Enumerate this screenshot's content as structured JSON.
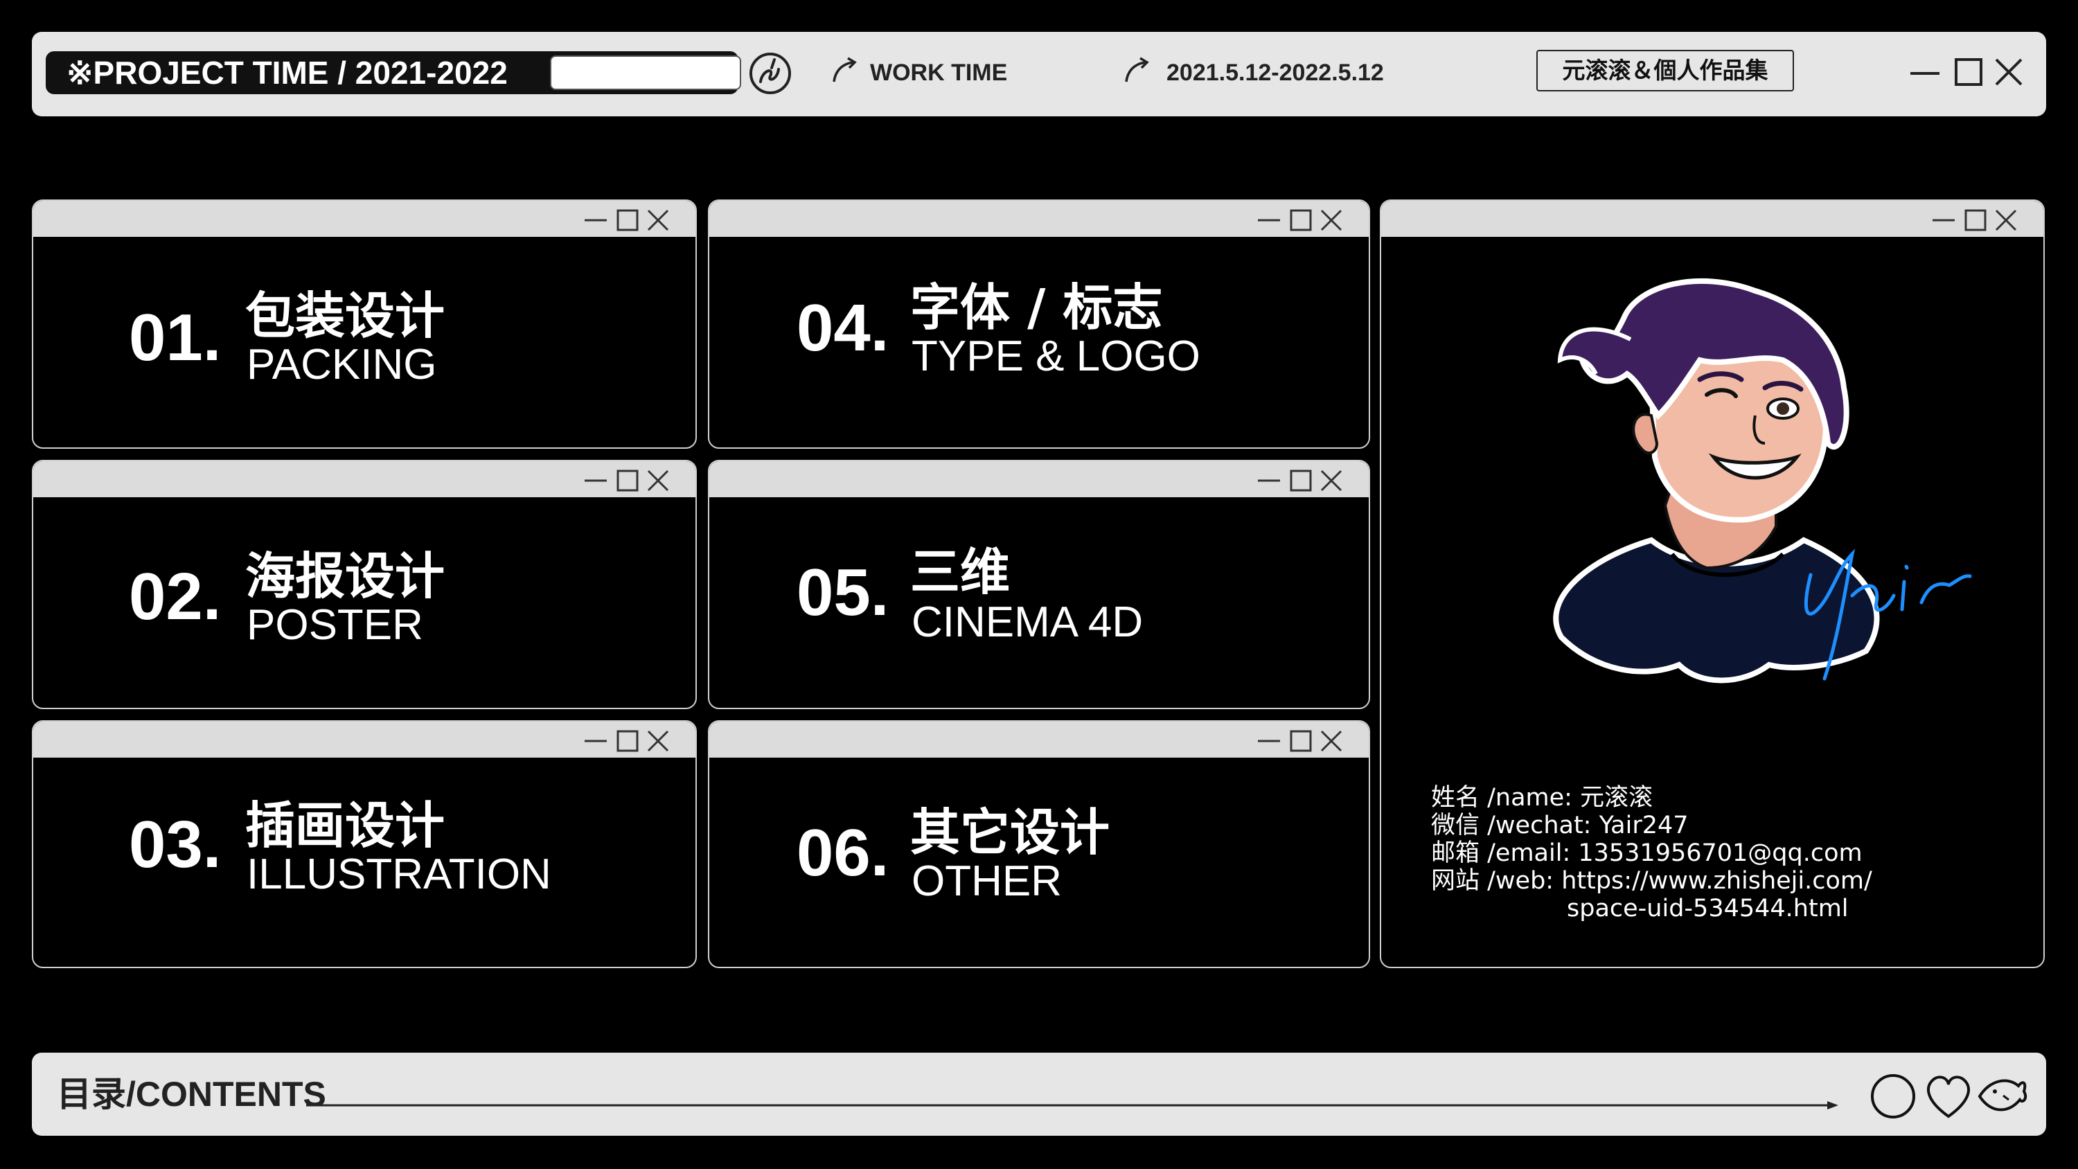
{
  "header": {
    "project_label": "※PROJECT TIME / 2021-2022",
    "work_time_label": "WORK TIME",
    "date_range": "2021.5.12-2022.5.12",
    "portfolio_title": "元滚滚＆個人作品集"
  },
  "cards": [
    {
      "num": "01.",
      "cn": "包装设计",
      "en": "PACKING"
    },
    {
      "num": "02.",
      "cn": "海报设计",
      "en": "POSTER"
    },
    {
      "num": "03.",
      "cn": "插画设计",
      "en": "ILLUSTRATION"
    },
    {
      "num": "04.",
      "cn": "字体 / 标志",
      "en": "TYPE & LOGO"
    },
    {
      "num": "05.",
      "cn": "三维",
      "en": "CINEMA 4D"
    },
    {
      "num": "06.",
      "cn": "其它设计",
      "en": "OTHER"
    }
  ],
  "profile": {
    "signature": "Yair",
    "name_line": "姓名 /name:  元滚滚",
    "wechat_line": "微信 /wechat:  Yair247",
    "email_line": "邮箱 /email:  13531956701@qq.com",
    "web_line": "网站 /web:  https://www.zhisheji.com/",
    "web_line2": "space-uid-534544.html"
  },
  "footer": {
    "contents_label": "目录/CONTENTS"
  },
  "icons": [
    "swirl-icon",
    "arrow-icon",
    "minimize-icon",
    "maximize-icon",
    "close-icon",
    "circle-icon",
    "heart-icon",
    "fish-icon"
  ],
  "colors": {
    "bar": "#e6e6e6",
    "background": "#000000",
    "signature": "#1e8fff"
  }
}
